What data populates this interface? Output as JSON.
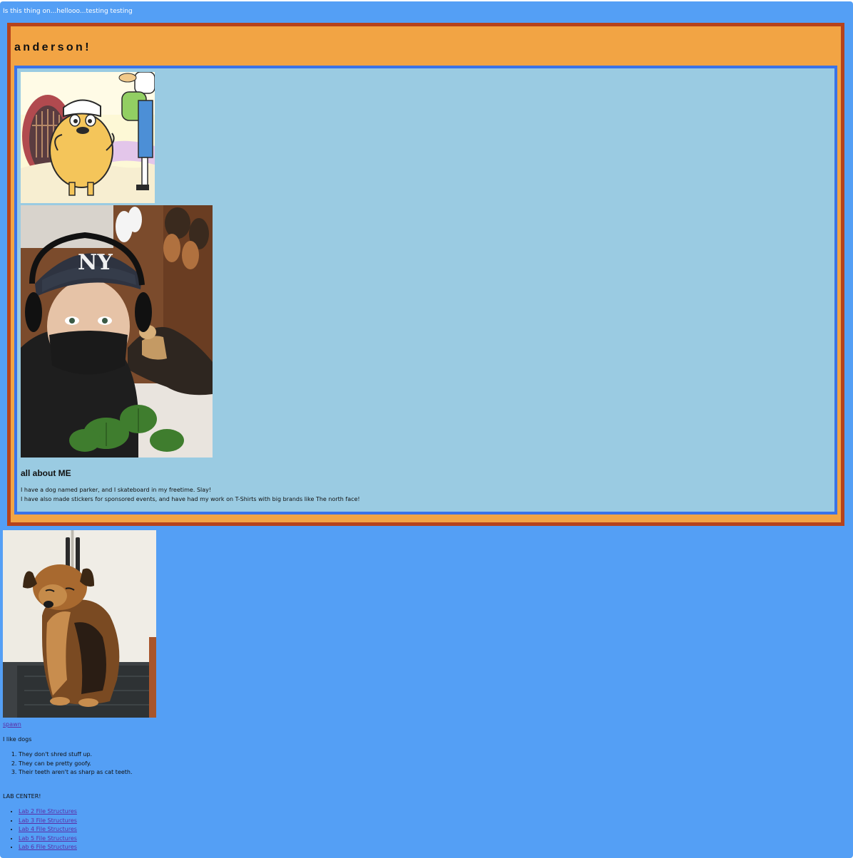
{
  "page": {
    "tagline": "Is this thing on...hellooo...testing testing"
  },
  "header": {
    "title": "anderson!"
  },
  "about": {
    "heading": "all about ME",
    "line1": "I have a dog named parker, and I skateboard in my freetime. Slay!",
    "line2": "I have also made stickers for sponsored events, and have had my work on T-Shirts with big brands like The north face!"
  },
  "images": {
    "cartoon": "cartoon-jake-and-finn-image",
    "selfie": "selfie-with-yankees-cap-and-dog-image",
    "dog": "dog-sitting-in-kitchen-image"
  },
  "links": {
    "spawn": "spawn"
  },
  "dogs": {
    "heading": "I like dogs",
    "reasons": [
      "They don't shred stuff up.",
      "They can be pretty goofy.",
      "Their teeth aren't as sharp as cat teeth."
    ]
  },
  "labs": {
    "heading": "LAB CENTER!",
    "items": [
      "Lab 2 File Structures",
      "Lab 3 File Structures",
      "Lab 4 File Structures",
      "Lab 5 File Structures",
      "Lab 6 File Structures"
    ]
  },
  "colors": {
    "page_background": "#549ff5",
    "outer_box": "#f2a444",
    "outer_border": "#b6431c",
    "inner_box": "#9acbe2",
    "inner_border": "#3b73e7",
    "link": "#5a2ca6"
  }
}
